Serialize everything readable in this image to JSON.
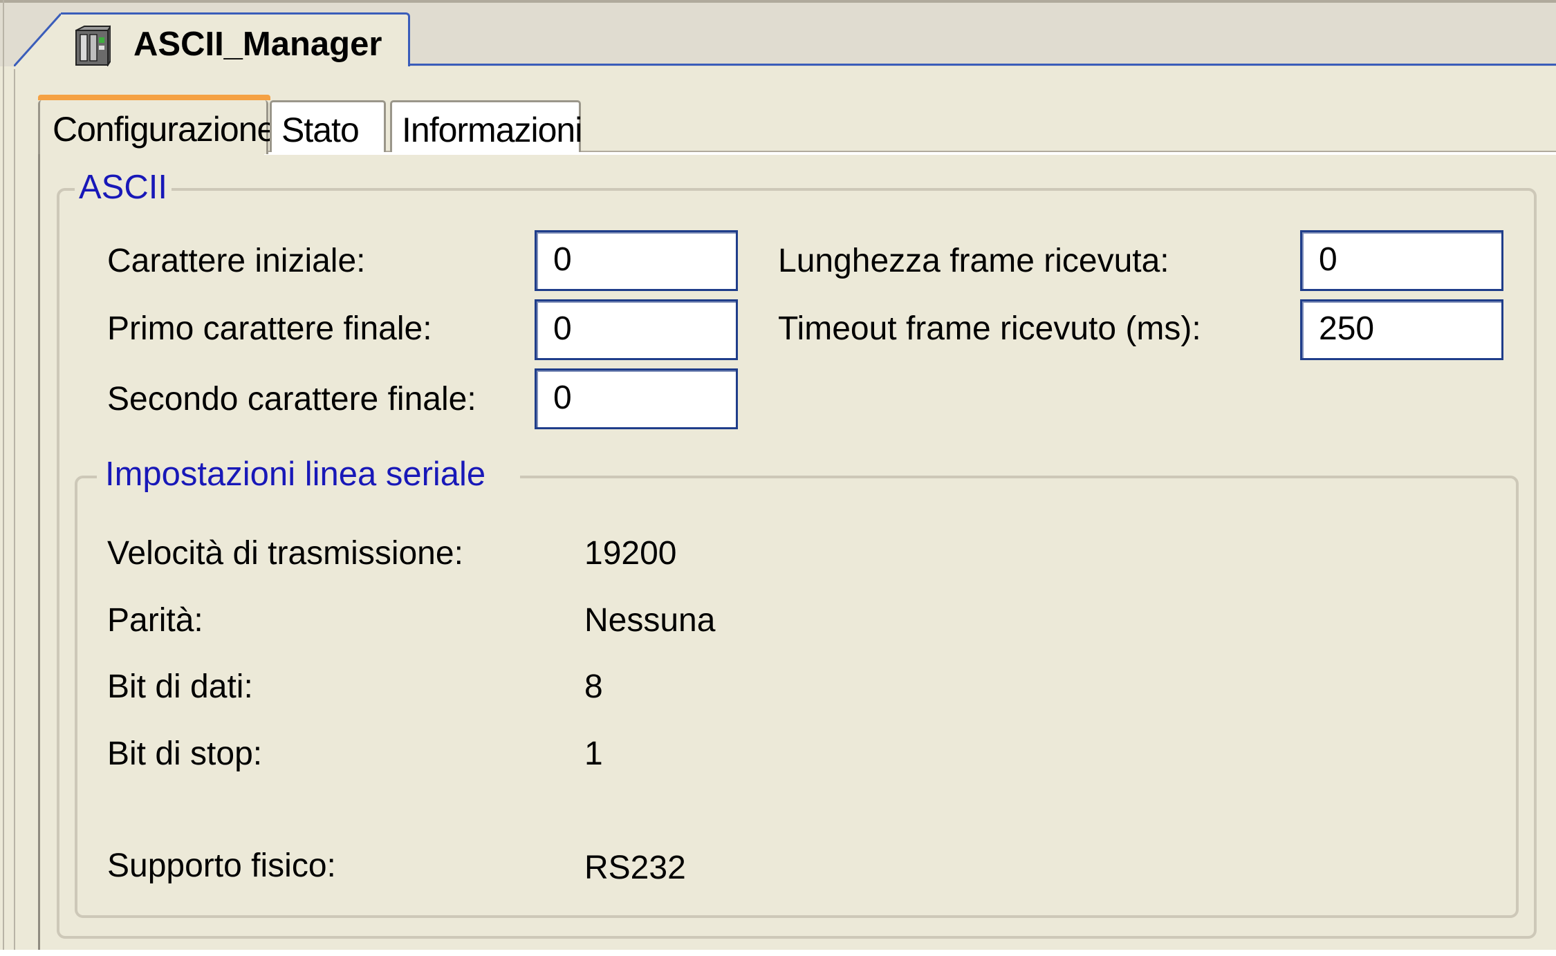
{
  "document": {
    "title": "ASCII_Manager",
    "icon": "module-icon"
  },
  "tabs": [
    {
      "label": "Configurazione",
      "active": true
    },
    {
      "label": "Stato",
      "active": false
    },
    {
      "label": "Informazioni",
      "active": false
    }
  ],
  "ascii_group": {
    "legend": "ASCII",
    "fields": {
      "start_char": {
        "label": "Carattere iniziale:",
        "value": "0"
      },
      "first_end_char": {
        "label": "Primo carattere finale:",
        "value": "0"
      },
      "second_end_char": {
        "label": "Secondo carattere finale:",
        "value": "0"
      },
      "frame_length": {
        "label": "Lunghezza frame ricevuta:",
        "value": "0"
      },
      "frame_timeout": {
        "label": "Timeout frame ricevuto (ms):",
        "value": "250"
      }
    }
  },
  "serial_group": {
    "legend": "Impostazioni linea seriale",
    "rows": {
      "baud": {
        "label": "Velocità di trasmissione:",
        "value": "19200"
      },
      "parity": {
        "label": "Parità:",
        "value": "Nessuna"
      },
      "data_bits": {
        "label": "Bit di dati:",
        "value": "8"
      },
      "stop_bits": {
        "label": "Bit di stop:",
        "value": "1"
      },
      "physical": {
        "label": "Supporto fisico:",
        "value": "RS232"
      }
    }
  },
  "colors": {
    "background": "#ece9d8",
    "legend_text": "#1818b8",
    "tab_accent": "#f5a143",
    "field_border": "#1f3d8a"
  }
}
